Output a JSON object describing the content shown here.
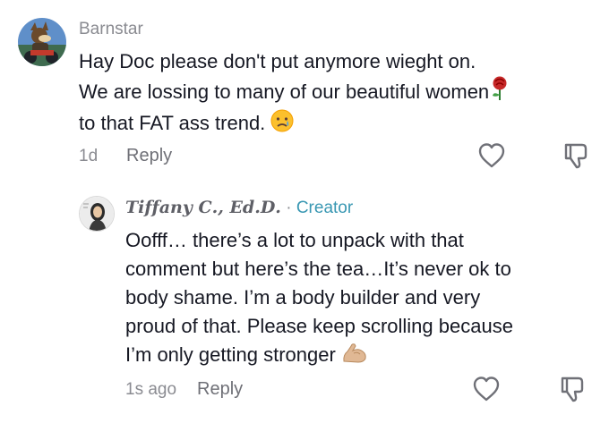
{
  "comments": [
    {
      "username": "Barnstar",
      "lines": [
        "Hay Doc please don't put anymore wieght on.",
        "We are lossing to many of our beautiful women",
        "to that FAT ass trend."
      ],
      "emojis": [
        "rose-emoji",
        "crying-face-emoji"
      ],
      "time": "1d",
      "reply_label": "Reply",
      "icons": [
        "heart-outline-icon",
        "thumbs-down-outline-icon"
      ]
    },
    {
      "username": "𝑻𝒊𝒇𝒇𝒂𝒏𝒚 𝑪., 𝑬𝒅.𝑫.",
      "separator": "·",
      "badge": "Creator",
      "lines": [
        "Oofff… there’s a lot to unpack with that",
        "comment but here’s the tea…It’s never ok to",
        "body shame. I’m a body builder and very",
        "proud of that. Please keep scrolling because",
        "I’m only getting stronger"
      ],
      "emojis": [
        "flexed-biceps-emoji"
      ],
      "time": "1s ago",
      "reply_label": "Reply",
      "icons": [
        "heart-outline-icon",
        "thumbs-down-outline-icon"
      ]
    }
  ],
  "colors": {
    "text": "#161823",
    "muted": "#8a8b91",
    "creator_badge": "#3a98b3",
    "background": "#ffffff"
  }
}
